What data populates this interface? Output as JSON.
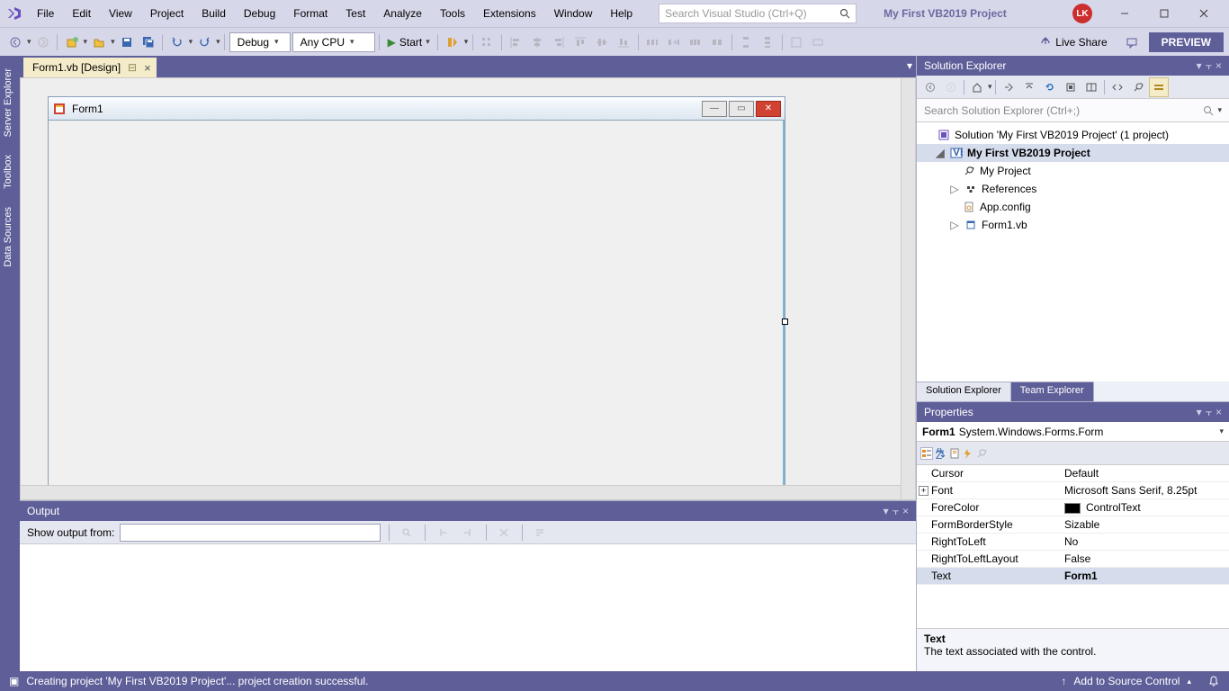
{
  "title": {
    "project_name": "My First VB2019 Project",
    "search_placeholder": "Search Visual Studio (Ctrl+Q)",
    "user_initials": "LK"
  },
  "menu": [
    "File",
    "Edit",
    "View",
    "Project",
    "Build",
    "Debug",
    "Format",
    "Test",
    "Analyze",
    "Tools",
    "Extensions",
    "Window",
    "Help"
  ],
  "toolbar": {
    "config": "Debug",
    "platform": "Any CPU",
    "start": "Start",
    "live_share": "Live Share",
    "preview": "PREVIEW"
  },
  "left_tabs": [
    "Server Explorer",
    "Toolbox",
    "Data Sources"
  ],
  "doc_tab": {
    "label": "Form1.vb [Design]"
  },
  "form": {
    "title": "Form1"
  },
  "output": {
    "title": "Output",
    "show_from": "Show output from:"
  },
  "solution_explorer": {
    "title": "Solution Explorer",
    "search_placeholder": "Search Solution Explorer (Ctrl+;)",
    "tree": {
      "solution": "Solution 'My First VB2019 Project' (1 project)",
      "project": "My First VB2019 Project",
      "items": [
        "My Project",
        "References",
        "App.config",
        "Form1.vb"
      ]
    },
    "tabs": [
      "Solution Explorer",
      "Team Explorer"
    ]
  },
  "properties": {
    "title": "Properties",
    "object_name": "Form1",
    "object_type": "System.Windows.Forms.Form",
    "rows": [
      {
        "name": "Cursor",
        "value": "Default"
      },
      {
        "name": "Font",
        "value": "Microsoft Sans Serif, 8.25pt",
        "expandable": true
      },
      {
        "name": "ForeColor",
        "value": "ControlText",
        "swatch": true
      },
      {
        "name": "FormBorderStyle",
        "value": "Sizable"
      },
      {
        "name": "RightToLeft",
        "value": "No"
      },
      {
        "name": "RightToLeftLayout",
        "value": "False"
      },
      {
        "name": "Text",
        "value": "Form1",
        "selected": true,
        "boldval": true
      }
    ],
    "desc_title": "Text",
    "desc_body": "The text associated with the control."
  },
  "status": {
    "message": "Creating project 'My First VB2019 Project'... project creation successful.",
    "source_control": "Add to Source Control"
  }
}
